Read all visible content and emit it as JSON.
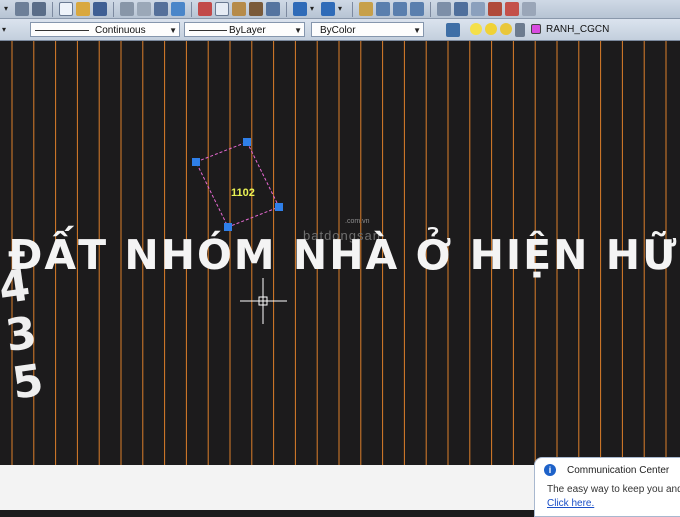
{
  "toolbar": {
    "properties": {
      "linetype_value": "Continuous",
      "lineweight_value": "ByLayer",
      "color_value": "ByColor"
    },
    "layer": {
      "name": "RANH_CGCN"
    }
  },
  "drawing": {
    "main_text": "ĐẤT NHÓM NHÀ Ở HIỆN HỮU",
    "vertical_text": "4 3 5",
    "polyline_label": "1102",
    "watermark_small": ".com.vn",
    "watermark": "batdongsan"
  },
  "notification": {
    "title": "Communication Center",
    "body": "The easy way to keep you and",
    "link": "Click here."
  },
  "colors": {
    "background": "#1c1b1c",
    "grid_line": "#f08a2c",
    "grip": "#2f7fe8",
    "selection": "#e86ad3",
    "label": "#e9f254"
  }
}
